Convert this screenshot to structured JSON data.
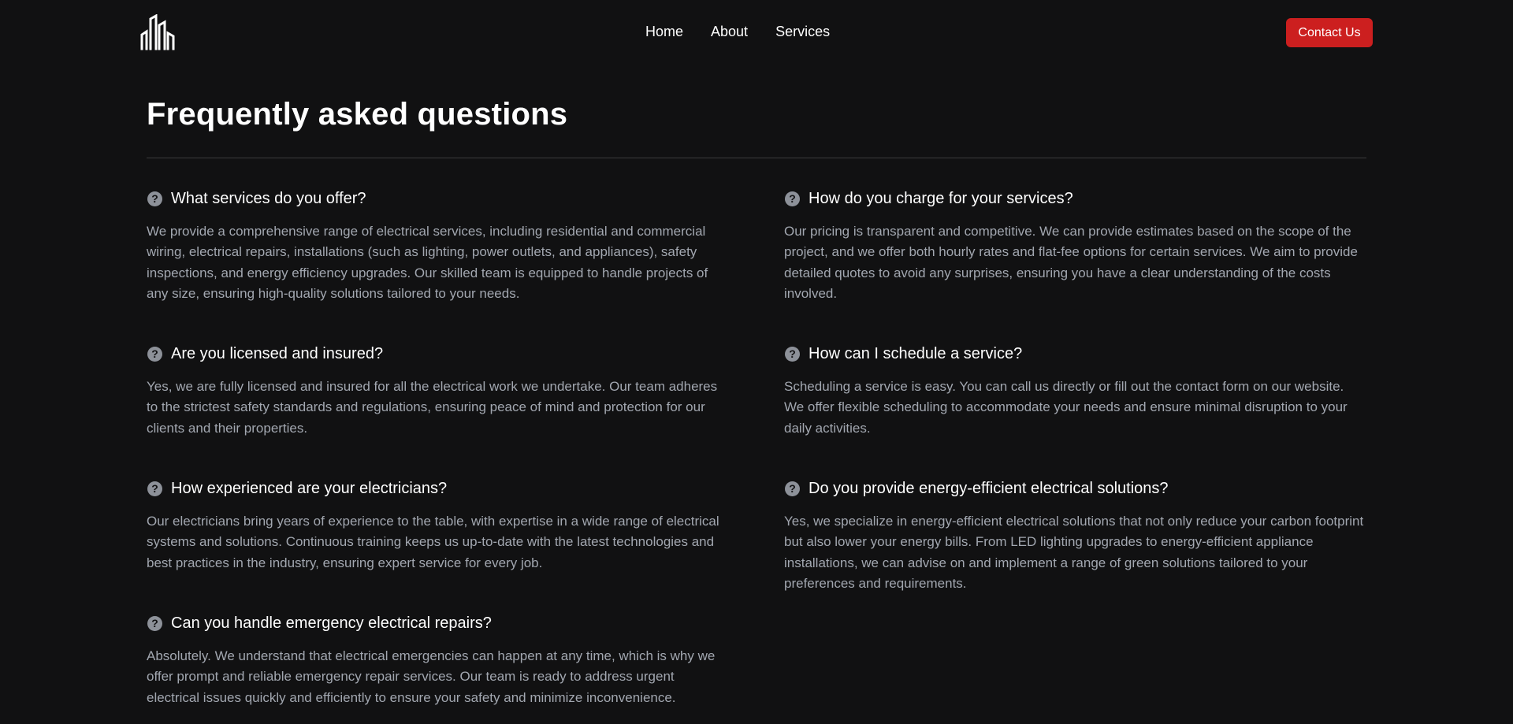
{
  "header": {
    "logo_icon": "city-buildings-logo-icon",
    "nav": [
      {
        "label": "Home"
      },
      {
        "label": "About"
      },
      {
        "label": "Services"
      }
    ],
    "contact_label": "Contact Us",
    "accent_color": "#cc1f1f"
  },
  "main": {
    "title": "Frequently asked questions",
    "question_icon": "question-circle-icon",
    "left": [
      {
        "question": "What services do you offer?",
        "answer": "We provide a comprehensive range of electrical services, including residential and commercial wiring, electrical repairs, installations (such as lighting, power outlets, and appliances), safety inspections, and energy efficiency upgrades. Our skilled team is equipped to handle projects of any size, ensuring high-quality solutions tailored to your needs."
      },
      {
        "question": "Are you licensed and insured?",
        "answer": "Yes, we are fully licensed and insured for all the electrical work we undertake. Our team adheres to the strictest safety standards and regulations, ensuring peace of mind and protection for our clients and their properties."
      },
      {
        "question": "How experienced are your electricians?",
        "answer": "Our electricians bring years of experience to the table, with expertise in a wide range of electrical systems and solutions. Continuous training keeps us up-to-date with the latest technologies and best practices in the industry, ensuring expert service for every job."
      },
      {
        "question": "Can you handle emergency electrical repairs?",
        "answer": "Absolutely. We understand that electrical emergencies can happen at any time, which is why we offer prompt and reliable emergency repair services. Our team is ready to address urgent electrical issues quickly and efficiently to ensure your safety and minimize inconvenience."
      }
    ],
    "right": [
      {
        "question": "How do you charge for your services?",
        "answer": "Our pricing is transparent and competitive. We can provide estimates based on the scope of the project, and we offer both hourly rates and flat-fee options for certain services. We aim to provide detailed quotes to avoid any surprises, ensuring you have a clear understanding of the costs involved."
      },
      {
        "question": "How can I schedule a service?",
        "answer": "Scheduling a service is easy. You can call us directly or fill out the contact form on our website. We offer flexible scheduling to accommodate your needs and ensure minimal disruption to your daily activities."
      },
      {
        "question": "Do you provide energy-efficient electrical solutions?",
        "answer": "Yes, we specialize in energy-efficient electrical solutions that not only reduce your carbon footprint but also lower your energy bills. From LED lighting upgrades to energy-efficient appliance installations, we can advise on and implement a range of green solutions tailored to your preferences and requirements."
      }
    ]
  }
}
